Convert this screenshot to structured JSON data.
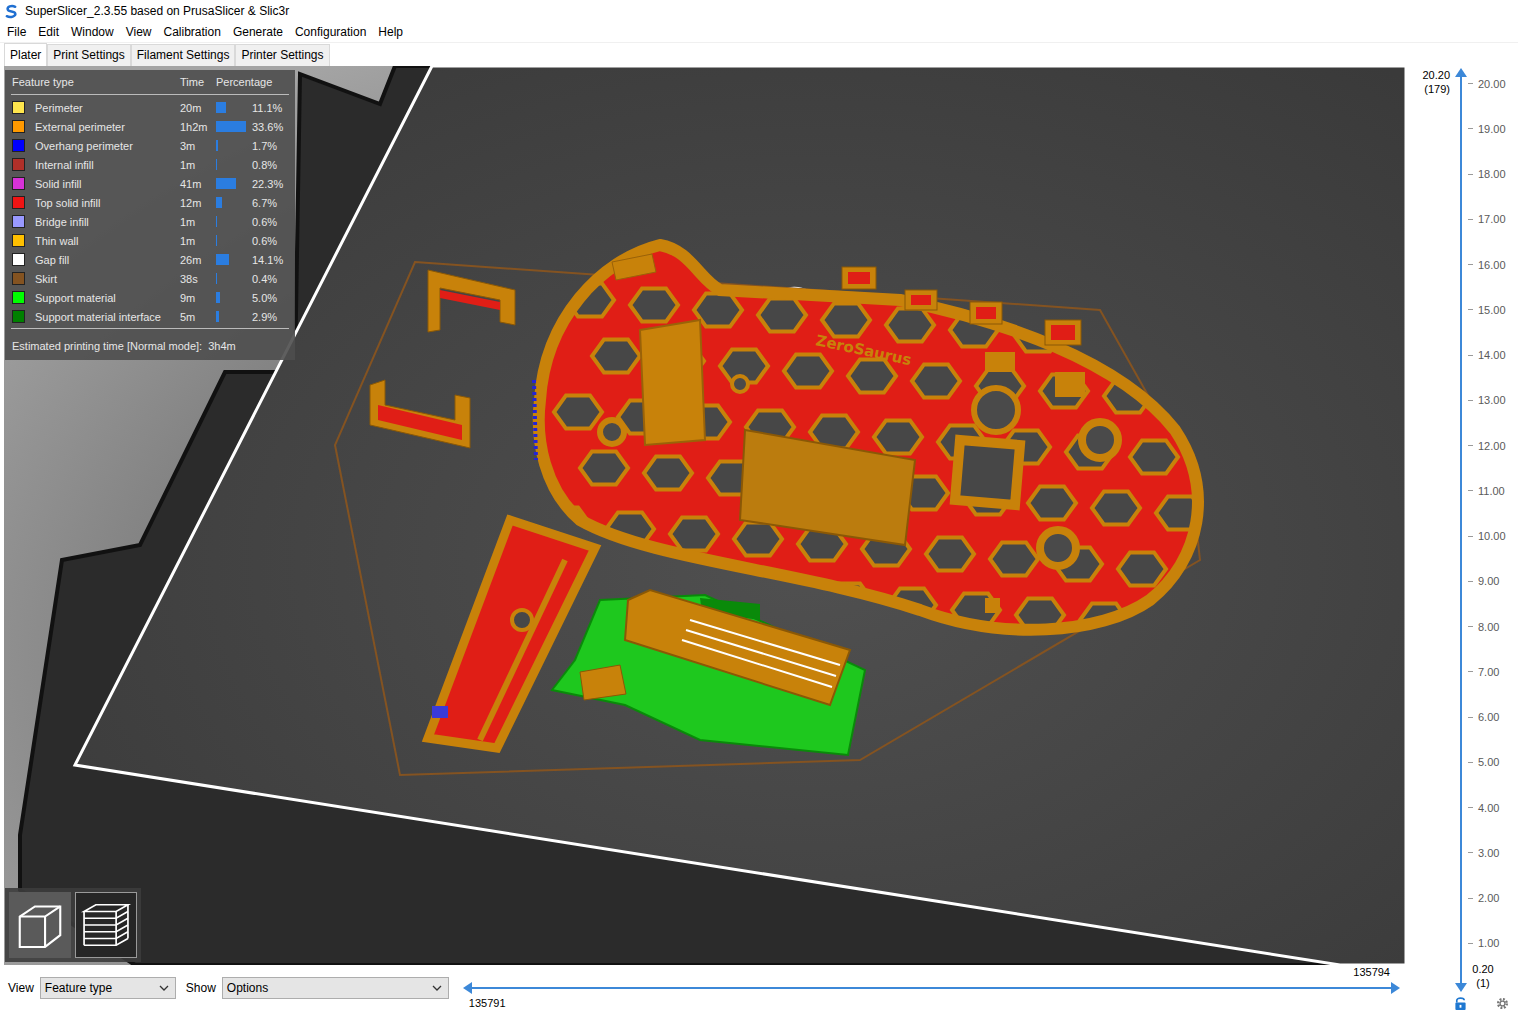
{
  "window": {
    "title": "SuperSlicer_2.3.55 based on PrusaSlicer & Slic3r"
  },
  "menu": [
    "File",
    "Edit",
    "Window",
    "View",
    "Calibration",
    "Generate",
    "Configuration",
    "Help"
  ],
  "tabs": [
    {
      "label": "Plater",
      "selected": true
    },
    {
      "label": "Print Settings",
      "selected": false
    },
    {
      "label": "Filament Settings",
      "selected": false
    },
    {
      "label": "Printer Settings",
      "selected": false
    }
  ],
  "legend": {
    "columns": [
      "Feature type",
      "Time",
      "Percentage"
    ],
    "rows": [
      {
        "name": "Perimeter",
        "time": "20m",
        "percentage": "11.1%",
        "level": 0.33,
        "color": "#ffe64d"
      },
      {
        "name": "External perimeter",
        "time": "1h2m",
        "percentage": "33.6%",
        "level": 1.0,
        "color": "#ff9900"
      },
      {
        "name": "Overhang perimeter",
        "time": "3m",
        "percentage": "1.7%",
        "level": 0.05,
        "color": "#0000ff"
      },
      {
        "name": "Internal infill",
        "time": "1m",
        "percentage": "0.8%",
        "level": 0.024,
        "color": "#b03029"
      },
      {
        "name": "Solid infill",
        "time": "41m",
        "percentage": "22.3%",
        "level": 0.664,
        "color": "#d732d7"
      },
      {
        "name": "Top solid infill",
        "time": "12m",
        "percentage": "6.7%",
        "level": 0.2,
        "color": "#f01414"
      },
      {
        "name": "Bridge infill",
        "time": "1m",
        "percentage": "0.6%",
        "level": 0.018,
        "color": "#9999ff"
      },
      {
        "name": "Thin wall",
        "time": "1m",
        "percentage": "0.6%",
        "level": 0.018,
        "color": "#ffc000"
      },
      {
        "name": "Gap fill",
        "time": "26m",
        "percentage": "14.1%",
        "level": 0.42,
        "color": "#ffffff"
      },
      {
        "name": "Skirt",
        "time": "38s",
        "percentage": "0.4%",
        "level": 0.012,
        "color": "#845321"
      },
      {
        "name": "Support material",
        "time": "9m",
        "percentage": "5.0%",
        "level": 0.149,
        "color": "#00ff00"
      },
      {
        "name": "Support material interface",
        "time": "5m",
        "percentage": "2.9%",
        "level": 0.086,
        "color": "#008000"
      }
    ],
    "estimate_label": "Estimated printing time [Normal mode]:",
    "estimate": "3h4m"
  },
  "model_label": "ZeroSaurus",
  "view_toggles": [
    {
      "kind": "3d",
      "selected": false
    },
    {
      "kind": "preview",
      "selected": true
    }
  ],
  "bottom_bar": {
    "view_label": "View",
    "view_value": "Feature type",
    "show_label": "Show",
    "show_value": "Options"
  },
  "horizontal_slider": {
    "low": "135791",
    "high": "135794",
    "low_level": 0,
    "high_level": 1
  },
  "vertical_slider": {
    "top_value": "20.20",
    "top_layer": "(179)",
    "bottom_value": "0.20",
    "bottom_layer": "(1)",
    "upper_level": 1,
    "lower_level": 0,
    "ticks": [
      "20.00",
      "19.00",
      "18.00",
      "17.00",
      "16.00",
      "15.00",
      "14.00",
      "13.00",
      "12.00",
      "11.00",
      "10.00",
      "9.00",
      "8.00",
      "7.00",
      "6.00",
      "5.00",
      "4.00",
      "3.00",
      "2.00",
      "1.00"
    ]
  }
}
